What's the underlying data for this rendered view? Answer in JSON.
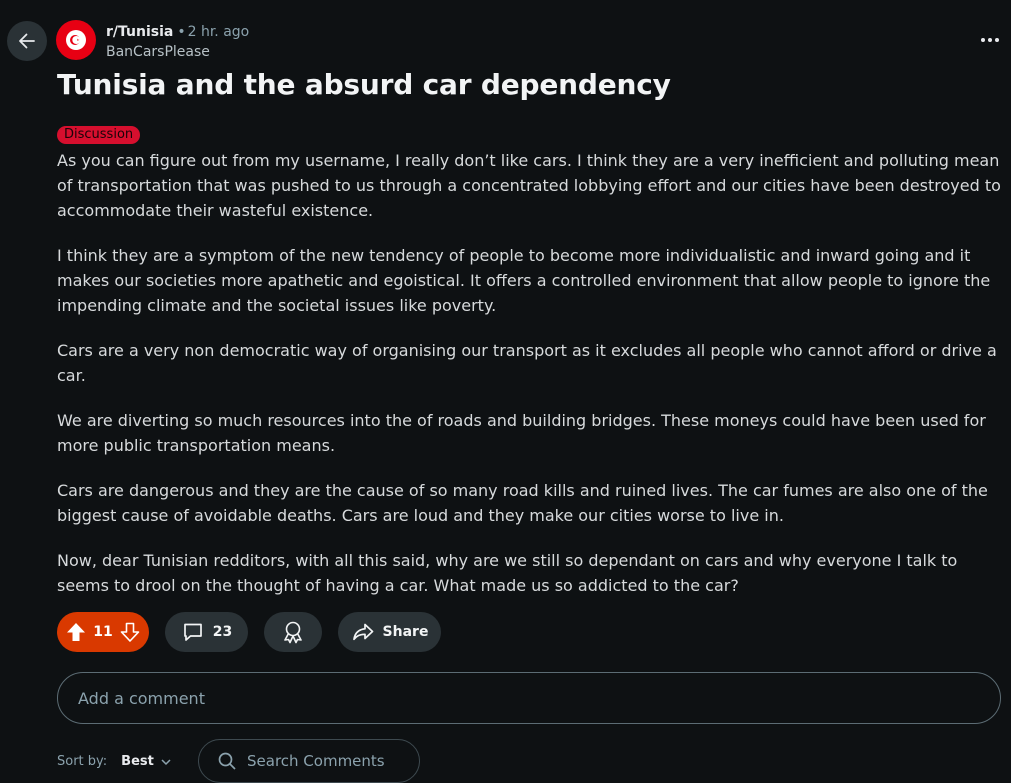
{
  "post": {
    "subreddit": "r/Tunisia",
    "separator": "•",
    "time": "2 hr. ago",
    "author": "BanCarsPlease",
    "title": "Tunisia and the absurd car dependency",
    "flair": "Discussion",
    "paragraphs": [
      "As you can figure out from my username, I really don’t like cars. I think they are a very inefficient and polluting mean of transportation that was pushed to us through a concentrated lobbying effort and our cities have been destroyed to accommodate their wasteful existence.",
      "I think they are a symptom of the new tendency of people to become more individualistic and inward going and it makes our societies more apathetic and egoistical. It offers a controlled environment that allow people to ignore the impending climate and the societal issues like poverty.",
      "Cars are a very non democratic way of organising our transport as it excludes all people who cannot afford or drive a car.",
      "We are diverting so much resources into the of roads and building bridges. These moneys could have been used for more public transportation means.",
      "Cars are dangerous and they are the cause of so many road kills and ruined lives. The car fumes are also one of the biggest cause of avoidable deaths. Cars are loud and they make our cities worse to live in.",
      "Now, dear Tunisian redditors, with all this said, why are we still so dependant on cars and why everyone I talk to seems to drool on the thought of having a car. What made us so addicted to the car?"
    ]
  },
  "actions": {
    "votes": "11",
    "comments": "23",
    "share_label": "Share"
  },
  "comment_box": {
    "placeholder": "Add a comment"
  },
  "sort": {
    "label": "Sort by:",
    "value": "Best"
  },
  "search": {
    "placeholder": "Search Comments"
  },
  "icons": {
    "back": "arrow-left-icon",
    "more": "more-horizontal-icon",
    "upvote": "upvote-arrow-icon",
    "downvote": "downvote-arrow-icon",
    "comment": "comment-bubble-icon",
    "award": "award-icon",
    "share": "share-arrow-icon",
    "search": "search-icon",
    "chevron": "chevron-down-icon"
  },
  "colors": {
    "background": "#0e1113",
    "vote_active": "#d93900",
    "flair": "#d60f2e",
    "subreddit_icon": "#e70013"
  }
}
